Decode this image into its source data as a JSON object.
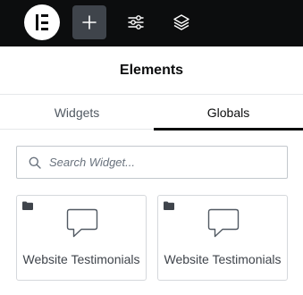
{
  "topbar": {
    "logo_icon": "elementor-logo-icon",
    "buttons": [
      {
        "name": "add-element-button",
        "icon": "plus-icon",
        "active": true
      },
      {
        "name": "site-settings-button",
        "icon": "sliders-icon",
        "active": false
      },
      {
        "name": "structure-button",
        "icon": "layers-icon",
        "active": false
      }
    ]
  },
  "panel": {
    "title": "Elements",
    "tabs": [
      {
        "label": "Widgets",
        "active": false
      },
      {
        "label": "Globals",
        "active": true
      }
    ],
    "search": {
      "placeholder": "Search Widget...",
      "value": ""
    },
    "cards": [
      {
        "label": "Website Testimonials",
        "icon": "testimonial-icon",
        "badge_icon": "folder-icon"
      },
      {
        "label": "Website Testimonials",
        "icon": "testimonial-icon",
        "badge_icon": "folder-icon"
      }
    ]
  },
  "colors": {
    "topbar_bg": "#0c0d0e",
    "active_button_bg": "#3f444b",
    "accent": "#0c0d0e",
    "border": "#d5d8dc"
  }
}
